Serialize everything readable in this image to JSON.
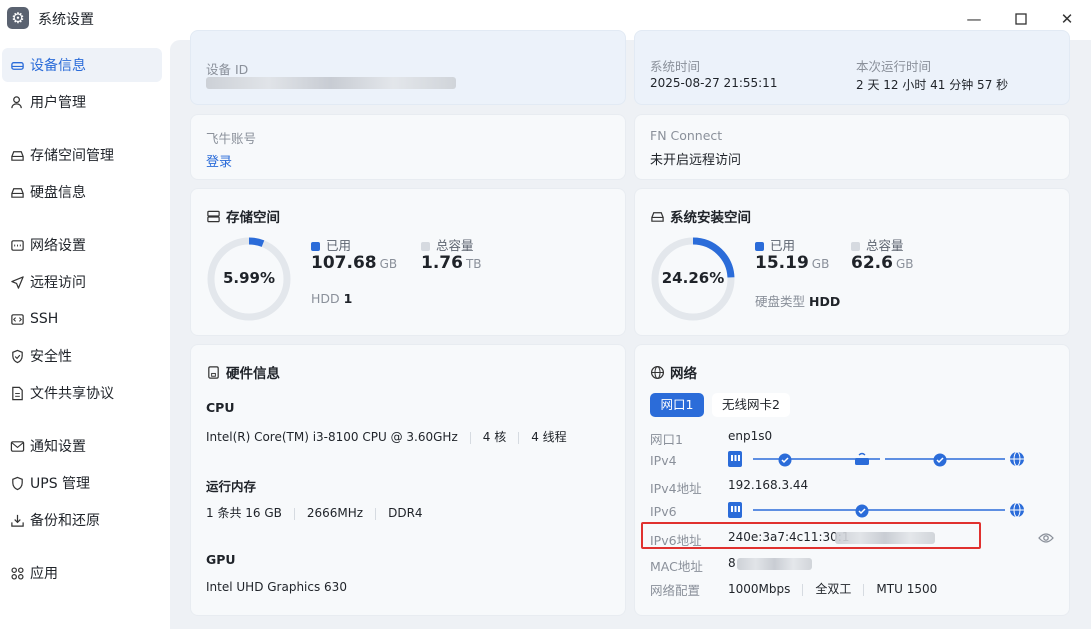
{
  "window": {
    "title": "系统设置",
    "app_icon": "gear-icon",
    "controls": {
      "minimize": "—",
      "maximize": "☐",
      "close": "✕"
    }
  },
  "sidebar": {
    "items": [
      {
        "label": "设备信息",
        "icon": "device-icon",
        "active": true
      },
      {
        "label": "用户管理",
        "icon": "user-icon"
      },
      {
        "label": "存储空间管理",
        "icon": "storage-icon"
      },
      {
        "label": "硬盘信息",
        "icon": "disk-icon"
      },
      {
        "label": "网络设置",
        "icon": "network-icon"
      },
      {
        "label": "远程访问",
        "icon": "send-icon"
      },
      {
        "label": "SSH",
        "icon": "ssh-icon"
      },
      {
        "label": "安全性",
        "icon": "shield-icon"
      },
      {
        "label": "文件共享协议",
        "icon": "file-icon"
      },
      {
        "label": "通知设置",
        "icon": "mail-icon"
      },
      {
        "label": "UPS 管理",
        "icon": "ups-icon"
      },
      {
        "label": "备份和还原",
        "icon": "backup-icon"
      },
      {
        "label": "应用",
        "icon": "apps-icon"
      }
    ]
  },
  "device": {
    "device_id_label": "设备 ID",
    "system_time_label": "系统时间",
    "system_time_value": "2025-08-27 21:55:11",
    "uptime_label": "本次运行时间",
    "uptime_value": "2 天 12 小时 41 分钟 57 秒",
    "account_label": "飞牛账号",
    "account_link": "登录",
    "fn_connect_label": "FN Connect",
    "fn_connect_value": "未开启远程访问"
  },
  "storage": {
    "title": "存储空间",
    "percent_text": "5.99%",
    "percent": 5.99,
    "used_label": "已用",
    "used_value": "107.68",
    "used_unit": "GB",
    "total_label": "总容量",
    "total_value": "1.76",
    "total_unit": "TB",
    "hdd_label": "HDD",
    "hdd_count": "1"
  },
  "system_space": {
    "title": "系统安装空间",
    "percent_text": "24.26%",
    "percent": 24.26,
    "used_label": "已用",
    "used_value": "15.19",
    "used_unit": "GB",
    "total_label": "总容量",
    "total_value": "62.6",
    "total_unit": "GB",
    "disk_type_label": "硬盘类型",
    "disk_type_value": "HDD"
  },
  "hardware": {
    "title": "硬件信息",
    "cpu_label": "CPU",
    "cpu_model": "Intel(R) Core(TM) i3-8100 CPU @ 3.60GHz",
    "cpu_cores": "4 核",
    "cpu_threads": "4 线程",
    "mem_label": "运行内存",
    "mem_total": "1 条共 16 GB",
    "mem_freq": "2666MHz",
    "mem_type": "DDR4",
    "gpu_label": "GPU",
    "gpu_model": "Intel UHD Graphics 630"
  },
  "network": {
    "title": "网络",
    "tabs": [
      "网口1",
      "无线网卡2"
    ],
    "port_label": "网口1",
    "port_value": "enp1s0",
    "ipv4_label": "IPv4",
    "ipv4_addr_label": "IPv4地址",
    "ipv4_addr_value": "192.168.3.44",
    "ipv6_label": "IPv6",
    "ipv6_addr_label": "IPv6地址",
    "ipv6_addr_value": "240e:3a7:4c11:30:1",
    "mac_label": "MAC地址",
    "mac_value": "8",
    "config_label": "网络配置",
    "config_speed": "1000Mbps",
    "config_duplex": "全双工",
    "config_mtu": "MTU 1500"
  },
  "colors": {
    "accent": "#2b6cd9",
    "ring_track": "#e3e7ec",
    "highlight": "#e0312f"
  }
}
